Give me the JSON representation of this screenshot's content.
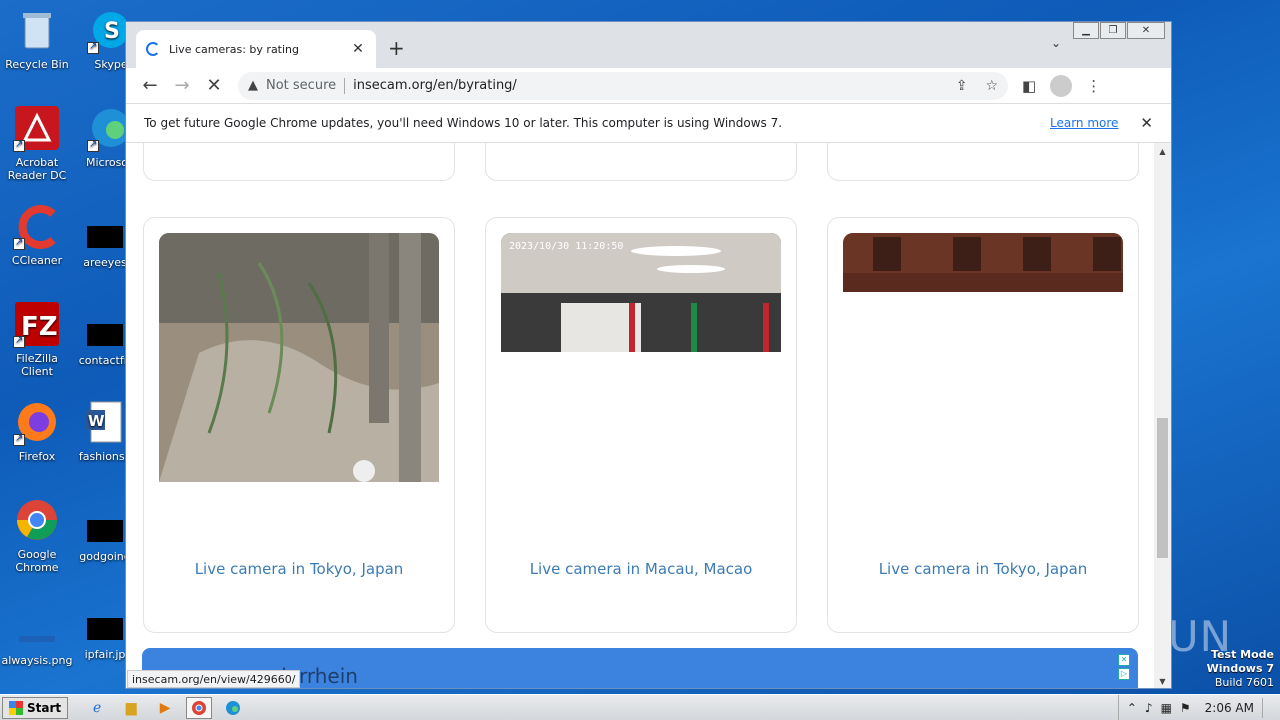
{
  "desktop": {
    "icons": [
      {
        "label": "Recycle Bin"
      },
      {
        "label": "Skype"
      },
      {
        "label": "Acrobat Reader DC"
      },
      {
        "label": "Microsoft"
      },
      {
        "label": "CCleaner"
      },
      {
        "label": "areeyes"
      },
      {
        "label": "FileZilla Client"
      },
      {
        "label": "contactfri"
      },
      {
        "label": "Firefox"
      },
      {
        "label": "fashionsy"
      },
      {
        "label": "Google Chrome"
      },
      {
        "label": "godgoing"
      },
      {
        "label": "alwaysis.png"
      },
      {
        "label": "ipfair.jp"
      }
    ],
    "watermark": "ANY RUN",
    "test_mode": {
      "line1": "Test Mode",
      "line2": "Windows 7",
      "line3": "Build 7601"
    }
  },
  "browser": {
    "tab": {
      "title": "Live cameras: by rating"
    },
    "address": {
      "security": "Not secure",
      "url": "insecam.org/en/byrating/"
    },
    "infobar": {
      "message": "To get future Google Chrome updates, you'll need Windows 10 or later. This computer is using Windows 7.",
      "link": "Learn more"
    },
    "cameras": [
      {
        "label": "Live camera in Tokyo, Japan",
        "overlay": ""
      },
      {
        "label": "Live camera in Macau, Macao",
        "overlay": "2023/10/30  11:20:50"
      },
      {
        "label": "Live camera in Tokyo, Japan",
        "overlay": ""
      }
    ],
    "banner_text": "derrhein",
    "status_url": "insecam.org/en/view/429660/"
  },
  "taskbar": {
    "start_label": "Start",
    "clock": "2:06 AM"
  }
}
